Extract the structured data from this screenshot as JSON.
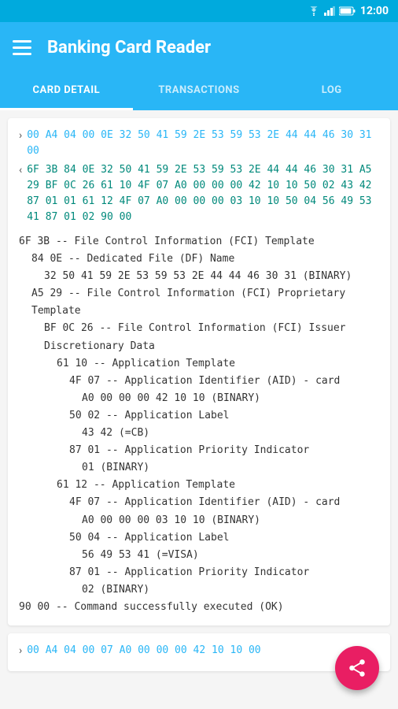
{
  "statusBar": {
    "time": "12:00"
  },
  "appBar": {
    "title": "Banking Card Reader"
  },
  "tabs": [
    {
      "label": "CARD DETAIL",
      "active": true
    },
    {
      "label": "TRANSACTIONS",
      "active": false
    },
    {
      "label": "LOG",
      "active": false
    }
  ],
  "cardSection1": {
    "commandHex": "00 A4 04 00 0E 32 50 41 59 2E 53 59 53 2E 44 44 46 30 31 00",
    "responseHex": "6F 3B 84 0E 32 50 41 59 2E 53 59 53 2E 44 44 46 30 31 A5 29 BF 0C 26 61 10 4F 07 A0 00 00 00 42 10 10 50 02 43 42 87 01 01 61 12 4F 07 A0 00 00 00 03 10 10 50 04 56 49 53 41 87 01 02 90 00"
  },
  "parsedLines": [
    {
      "indent": 0,
      "text": "6F 3B -- File Control Information (FCI) Template"
    },
    {
      "indent": 1,
      "text": "84 0E -- Dedicated File (DF) Name"
    },
    {
      "indent": 2,
      "text": "32 50 41 59 2E 53 59 53 2E 44 44 46 30 31 (BINARY)"
    },
    {
      "indent": 1,
      "text": "A5 29 -- File Control Information (FCI) Proprietary Template"
    },
    {
      "indent": 2,
      "text": "BF 0C 26 -- File Control Information (FCI) Issuer Discretionary Data"
    },
    {
      "indent": 3,
      "text": "61 10 -- Application Template"
    },
    {
      "indent": 4,
      "text": "4F 07 -- Application Identifier (AID) - card"
    },
    {
      "indent": 5,
      "text": "A0 00 00 00 42 10 10 (BINARY)"
    },
    {
      "indent": 4,
      "text": "50 02 -- Application Label"
    },
    {
      "indent": 5,
      "text": "43 42 (=CB)"
    },
    {
      "indent": 4,
      "text": "87 01 -- Application Priority Indicator"
    },
    {
      "indent": 5,
      "text": "01 (BINARY)"
    },
    {
      "indent": 3,
      "text": "61 12 -- Application Template"
    },
    {
      "indent": 4,
      "text": "4F 07 -- Application Identifier (AID) - card"
    },
    {
      "indent": 5,
      "text": "A0 00 00 00 03 10 10 (BINARY)"
    },
    {
      "indent": 4,
      "text": "50 04 -- Application Label"
    },
    {
      "indent": 5,
      "text": "56 49 53 41 (=VISA)"
    },
    {
      "indent": 4,
      "text": "87 01 -- Application Priority Indicator"
    },
    {
      "indent": 5,
      "text": "02 (BINARY)"
    },
    {
      "indent": 0,
      "text": "90 00 -- Command successfully executed (OK)"
    }
  ],
  "cardSection2": {
    "commandHex": "00 A4 04 00 07 A0 00 00 00 42 10 10 00"
  }
}
